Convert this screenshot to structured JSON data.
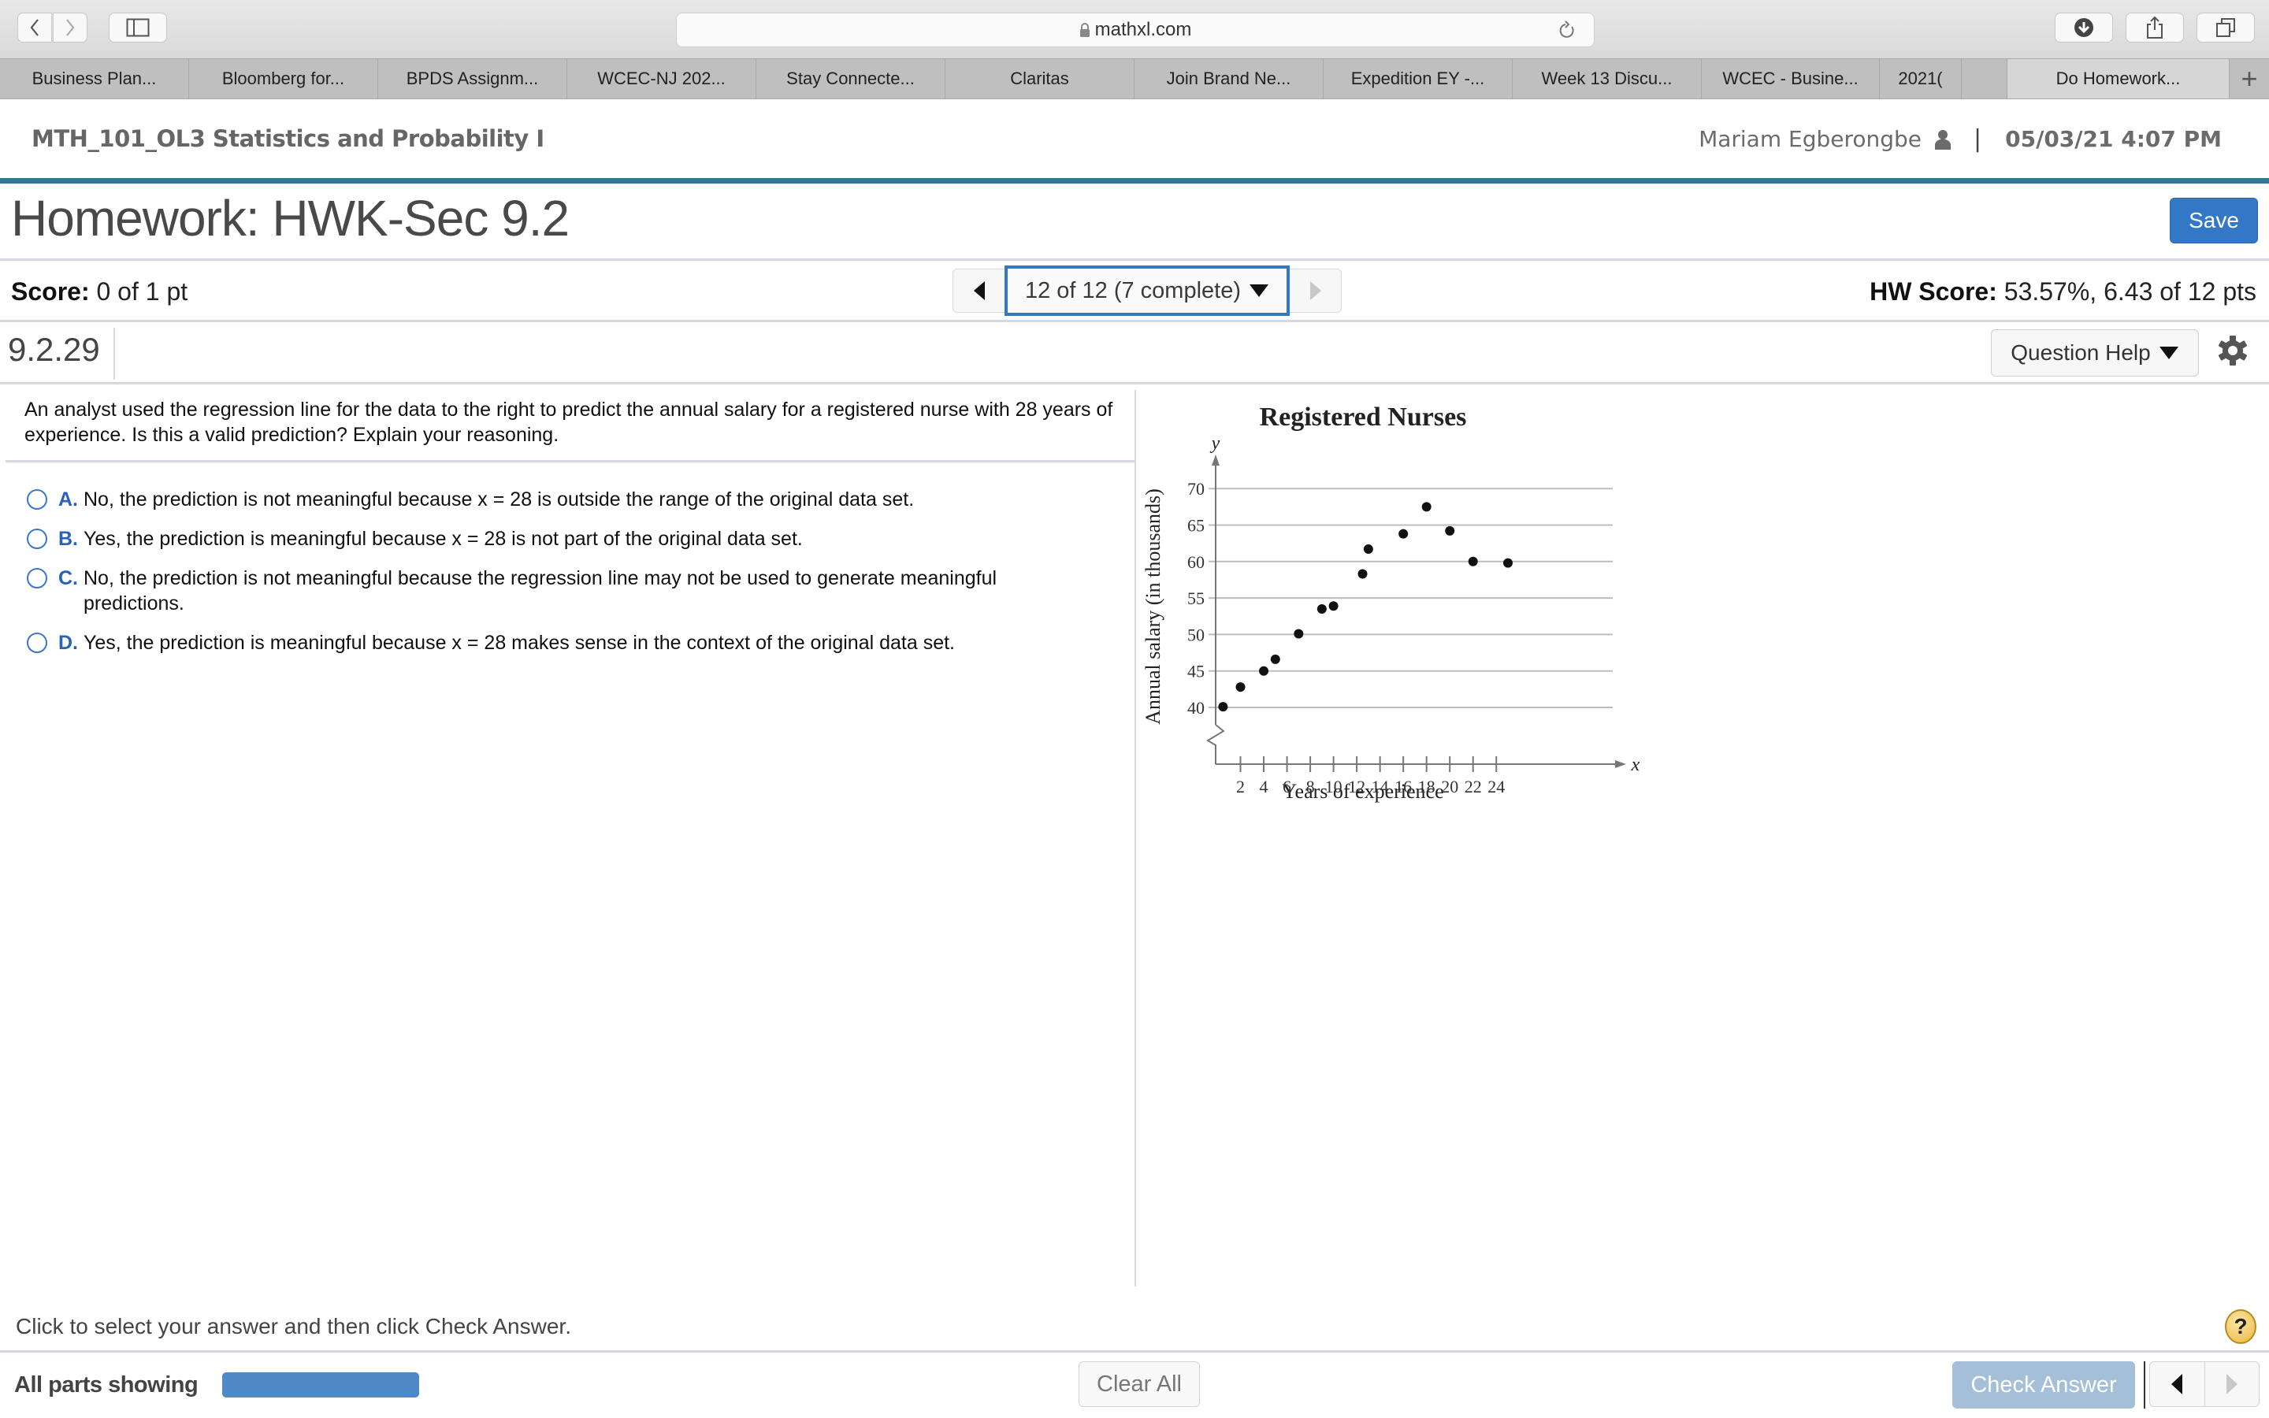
{
  "browser": {
    "url": "mathxl.com",
    "tabs": [
      {
        "label": "Business Plan...",
        "active": false
      },
      {
        "label": "Bloomberg for...",
        "active": false
      },
      {
        "label": "BPDS Assignm...",
        "active": false
      },
      {
        "label": "WCEC-NJ 202...",
        "active": false
      },
      {
        "label": "Stay Connecte...",
        "active": false
      },
      {
        "label": "Claritas",
        "active": false
      },
      {
        "label": "Join Brand Ne...",
        "active": false
      },
      {
        "label": "Expedition EY -...",
        "active": false
      },
      {
        "label": "Week 13 Discu...",
        "active": false
      },
      {
        "label": "WCEC - Busine...",
        "active": false
      },
      {
        "label": "2021(",
        "active": false
      },
      {
        "label": "",
        "active": false
      },
      {
        "label": "Do Homework...",
        "active": true
      }
    ]
  },
  "header": {
    "course_title": "MTH_101_OL3 Statistics and Probability I",
    "user_name": "Mariam Egberongbe",
    "separator": "|",
    "datetime": "05/03/21 4:07 PM"
  },
  "homework": {
    "title": "Homework: HWK-Sec 9.2",
    "save_label": "Save",
    "score_label": "Score:",
    "score_value": "0 of 1 pt",
    "question_selector": "12 of 12 (7 complete)",
    "hw_score_label": "HW Score:",
    "hw_score_value": "53.57%, 6.43 of 12 pts",
    "question_number": "9.2.29",
    "question_help_label": "Question Help"
  },
  "question": {
    "text": "An analyst used the regression line for the data to the right to predict the annual salary for a registered nurse with 28 years of experience. Is this a valid prediction? Explain your reasoning.",
    "options": [
      {
        "letter": "A.",
        "text": "No, the prediction is not meaningful because x = 28 is outside the range of the original data set.",
        "selected": false
      },
      {
        "letter": "B.",
        "text": "Yes, the prediction is meaningful because x = 28 is not part of the original data set.",
        "selected": false
      },
      {
        "letter": "C.",
        "text": "No, the prediction is not meaningful because the regression line may not be used to generate meaningful predictions.",
        "selected": false
      },
      {
        "letter": "D.",
        "text": "Yes, the prediction is meaningful because x = 28 makes sense in the context of the original data set.",
        "selected": false
      }
    ]
  },
  "chart_data": {
    "type": "scatter",
    "title": "Registered Nurses",
    "xlabel": "Years of experience",
    "ylabel": "Annual salary (in thousands)",
    "x_axis_letter": "x",
    "y_axis_letter": "y",
    "xlim": [
      0,
      25
    ],
    "ylim": [
      40,
      70
    ],
    "y_axis_break": true,
    "grid": "horizontal",
    "xticks": [
      2,
      4,
      6,
      8,
      10,
      12,
      14,
      16,
      18,
      20,
      22,
      24
    ],
    "yticks": [
      40,
      45,
      50,
      55,
      60,
      65,
      70
    ],
    "points": [
      {
        "x": 0.5,
        "y": 40.1
      },
      {
        "x": 2,
        "y": 42.8
      },
      {
        "x": 4,
        "y": 45.0
      },
      {
        "x": 5,
        "y": 46.6
      },
      {
        "x": 7,
        "y": 50.1
      },
      {
        "x": 9,
        "y": 53.5
      },
      {
        "x": 10,
        "y": 53.9
      },
      {
        "x": 12.5,
        "y": 58.3
      },
      {
        "x": 13,
        "y": 61.7
      },
      {
        "x": 16,
        "y": 63.8
      },
      {
        "x": 18,
        "y": 67.5
      },
      {
        "x": 20,
        "y": 64.2
      },
      {
        "x": 22,
        "y": 60.0
      },
      {
        "x": 25,
        "y": 59.8
      }
    ]
  },
  "footer": {
    "instruction": "Click to select your answer and then click Check Answer.",
    "help_symbol": "?",
    "parts_label": "All parts showing",
    "clear_label": "Clear All",
    "check_label": "Check Answer"
  },
  "colors": {
    "accent_blue": "#3278c6",
    "teal_rule": "#2f7896",
    "check_disabled": "#a5bfd9",
    "parts_bar": "#508ac6"
  }
}
